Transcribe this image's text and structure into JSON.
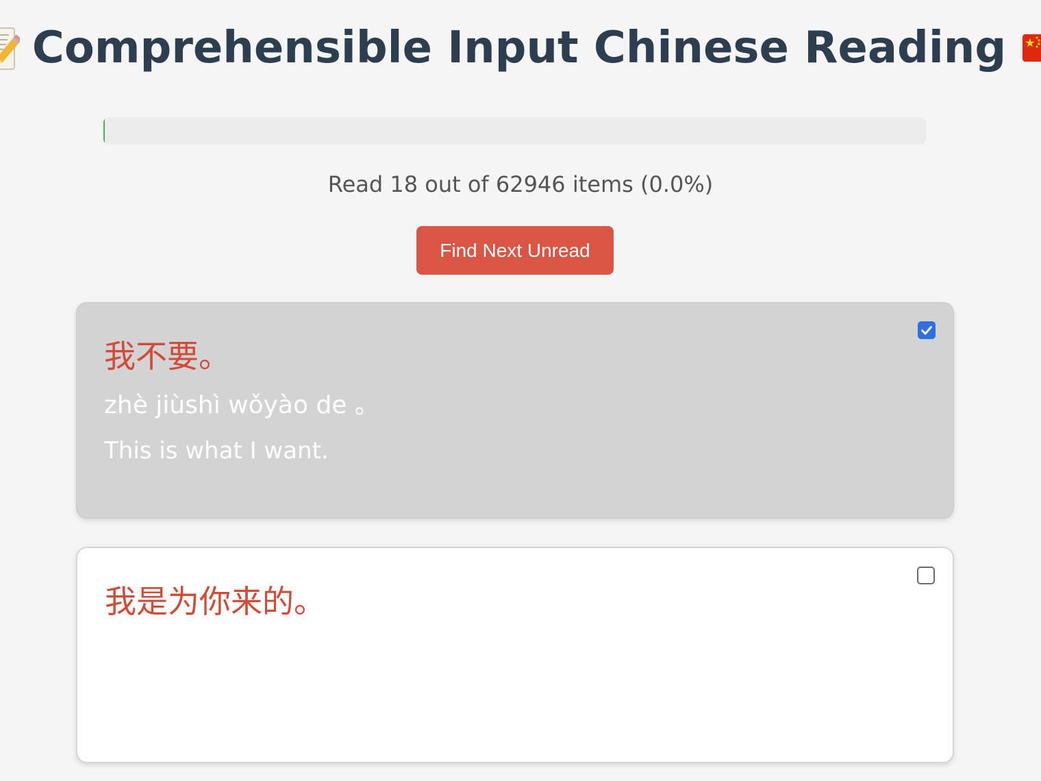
{
  "header": {
    "title": "Comprehensible Input Chinese Reading",
    "leading_icon": "memo-icon",
    "trailing_icon": "china-flag-icon"
  },
  "progress": {
    "read_count": 18,
    "total_count": 62946,
    "fraction": 0.00029,
    "text": "Read 18 out of 62946 items (0.0%)",
    "fill_color": "#4caf50"
  },
  "actions": {
    "find_next_label": "Find Next Unread",
    "button_color": "#d95645"
  },
  "cards": [
    {
      "hanzi": "我不要。",
      "pinyin": "zhè jiùshì wǒyào de 。",
      "translation": "This is what I want.",
      "checked": true
    },
    {
      "hanzi": "我是为你来的。",
      "pinyin": "",
      "translation": "",
      "checked": false
    }
  ],
  "colors": {
    "title": "#2c3e50",
    "hanzi": "#d04b38",
    "read_card_bg": "#d3d3d3",
    "checkbox_checked": "#2f6fe0"
  }
}
